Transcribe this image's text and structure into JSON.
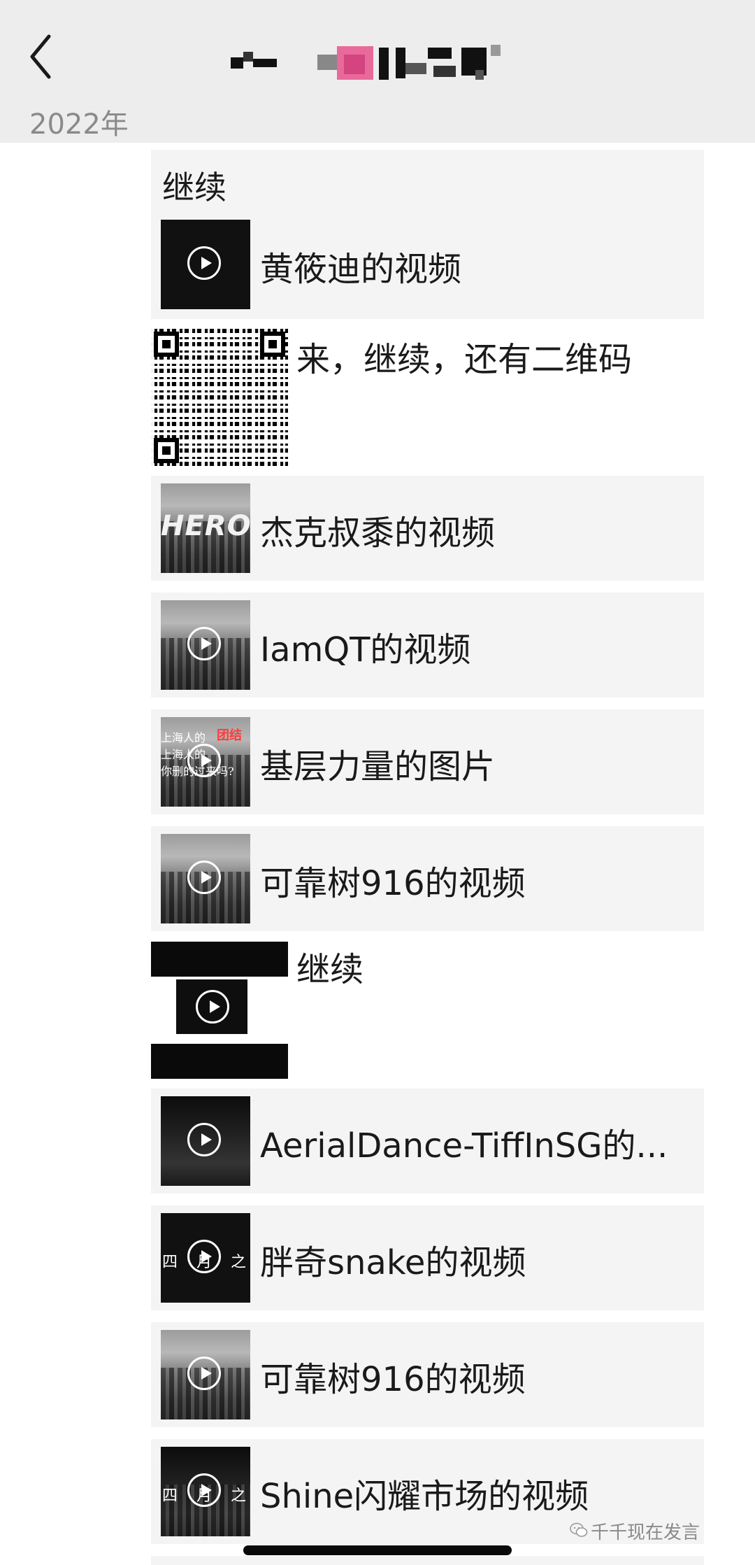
{
  "header": {
    "title": "",
    "back_icon": "chevron-left-icon"
  },
  "date_group": "2022年",
  "items": [
    {
      "kind": "card-with-label",
      "label": "继续",
      "text": "黄筱迪的视频",
      "thumb": "black",
      "play": true
    },
    {
      "kind": "qr-message",
      "text": "来，继续，还有二维码"
    },
    {
      "kind": "card",
      "text": "杰克叔黍的视频",
      "thumb": "hero",
      "play": false,
      "thumb_overlay": "HERO"
    },
    {
      "kind": "card",
      "text": "IamQT的视频",
      "thumb": "city",
      "play": true
    },
    {
      "kind": "card",
      "text": "基层力量的图片",
      "thumb": "city-text",
      "play": true,
      "thumb_overlay_lines": [
        "上海人的",
        "上海人的",
        "你删的过来吗?"
      ],
      "thumb_overlay_red": "团结"
    },
    {
      "kind": "card",
      "text": "可靠树916的视频",
      "thumb": "city",
      "play": true
    },
    {
      "kind": "screenshot-message",
      "text": "继续"
    },
    {
      "kind": "card",
      "text": "AerialDance-TiffInSG的...",
      "thumb": "dark",
      "play": true
    },
    {
      "kind": "card",
      "text": "胖奇snake的视频",
      "thumb": "black-text",
      "play": true,
      "thumb_overlay": "四 月 之 声"
    },
    {
      "kind": "card",
      "text": "可靠树916的视频",
      "thumb": "city",
      "play": true
    },
    {
      "kind": "card",
      "text": "Shine闪耀市场的视频",
      "thumb": "city-text",
      "play": true,
      "thumb_overlay": "四 月 之 声"
    }
  ],
  "watermark": "千千现在发言",
  "watermark_icon": "wechat-icon"
}
